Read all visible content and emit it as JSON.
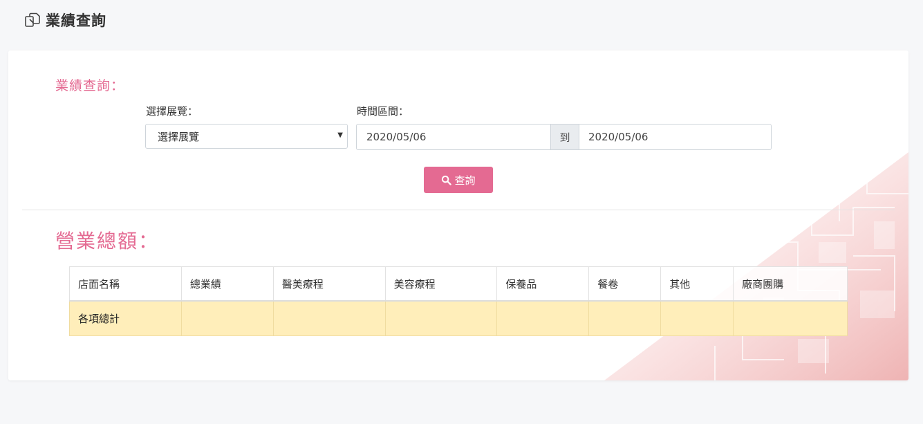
{
  "header": {
    "title": "業績查詢",
    "icon": "copy-icon"
  },
  "filter": {
    "section_label": "業績查詢：",
    "exhibition_label": "選擇展覽：",
    "exhibition_selected": "選擇展覽",
    "range_label": "時間區間：",
    "start_date": "2020/05/06",
    "range_separator": "到",
    "end_date": "2020/05/06",
    "query_button": "查詢"
  },
  "summary": {
    "title": "營業總額：",
    "columns": [
      "店面名稱",
      "總業績",
      "醫美療程",
      "美容療程",
      "保養品",
      "餐卷",
      "其他",
      "廠商團購"
    ],
    "rows": [
      {
        "label": "各項總計",
        "values": [
          "",
          "",
          "",
          "",
          "",
          "",
          ""
        ]
      }
    ]
  },
  "colors": {
    "accent": "#e46a92",
    "total_row": "#ffeeba",
    "background": "#f6f7f9"
  }
}
